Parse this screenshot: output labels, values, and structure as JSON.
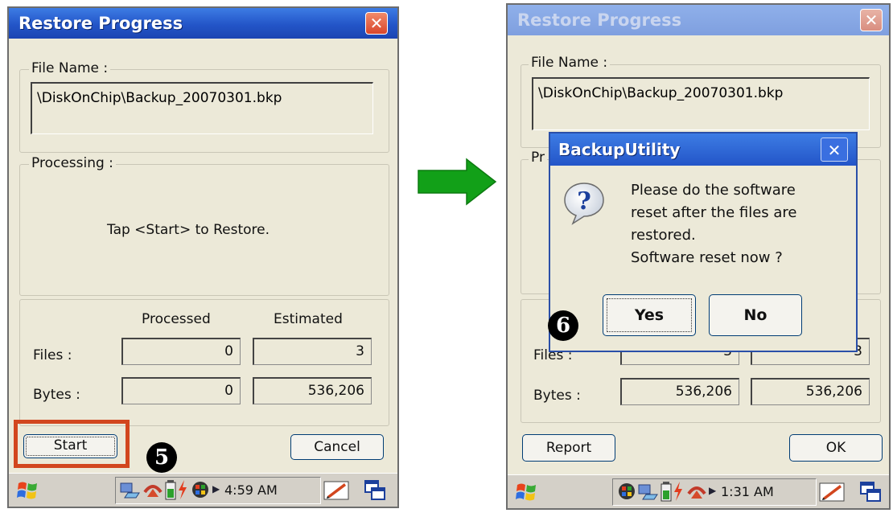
{
  "left": {
    "title": "Restore Progress",
    "close_glyph": "✕",
    "file_name_label": "File Name :",
    "file_path": "\\DiskOnChip\\Backup_20070301.bkp",
    "processing_label": "Processing :",
    "status_text": "Tap <Start> to Restore.",
    "processed_header": "Processed",
    "estimated_header": "Estimated",
    "files_label": "Files :",
    "bytes_label": "Bytes :",
    "files_processed": "0",
    "files_estimated": "3",
    "bytes_processed": "0",
    "bytes_estimated": "536,206",
    "start_button": "Start",
    "cancel_button": "Cancel",
    "step_marker": "5",
    "highlight_color": "#d2461e",
    "taskbar": {
      "start_icon": "windows-flag-icon",
      "tray_icons": [
        "network-icon",
        "sync-icon",
        "battery-icon",
        "power-icon",
        "color-icon"
      ],
      "time": "4:59 AM",
      "input_icon": "pen-input-icon",
      "windows_icon": "switch-windows-icon"
    }
  },
  "arrow_color": "#12a018",
  "right": {
    "title": "Restore Progress",
    "close_glyph": "✕",
    "file_name_label": "File Name :",
    "file_path": "\\DiskOnChip\\Backup_20070301.bkp",
    "processing_label_partial": "Pr",
    "files_label": "Files :",
    "bytes_label": "Bytes :",
    "files_processed": "3",
    "files_estimated": "3",
    "bytes_processed": "536,206",
    "bytes_estimated": "536,206",
    "report_button": "Report",
    "ok_button": "OK",
    "step_marker": "6",
    "taskbar": {
      "start_icon": "windows-flag-icon",
      "tray_icons": [
        "color-icon",
        "network-icon",
        "battery-icon",
        "power-icon",
        "sync-icon"
      ],
      "time": "1:31 AM",
      "input_icon": "pen-input-icon",
      "windows_icon": "switch-windows-icon"
    },
    "dialog": {
      "title": "BackupUtility",
      "close_glyph": "✕",
      "icon": "question-icon",
      "message_lines": [
        "Please do the software",
        "reset after the files are",
        "restored.",
        "Software reset now ?"
      ],
      "yes_button": "Yes",
      "no_button": "No"
    }
  }
}
